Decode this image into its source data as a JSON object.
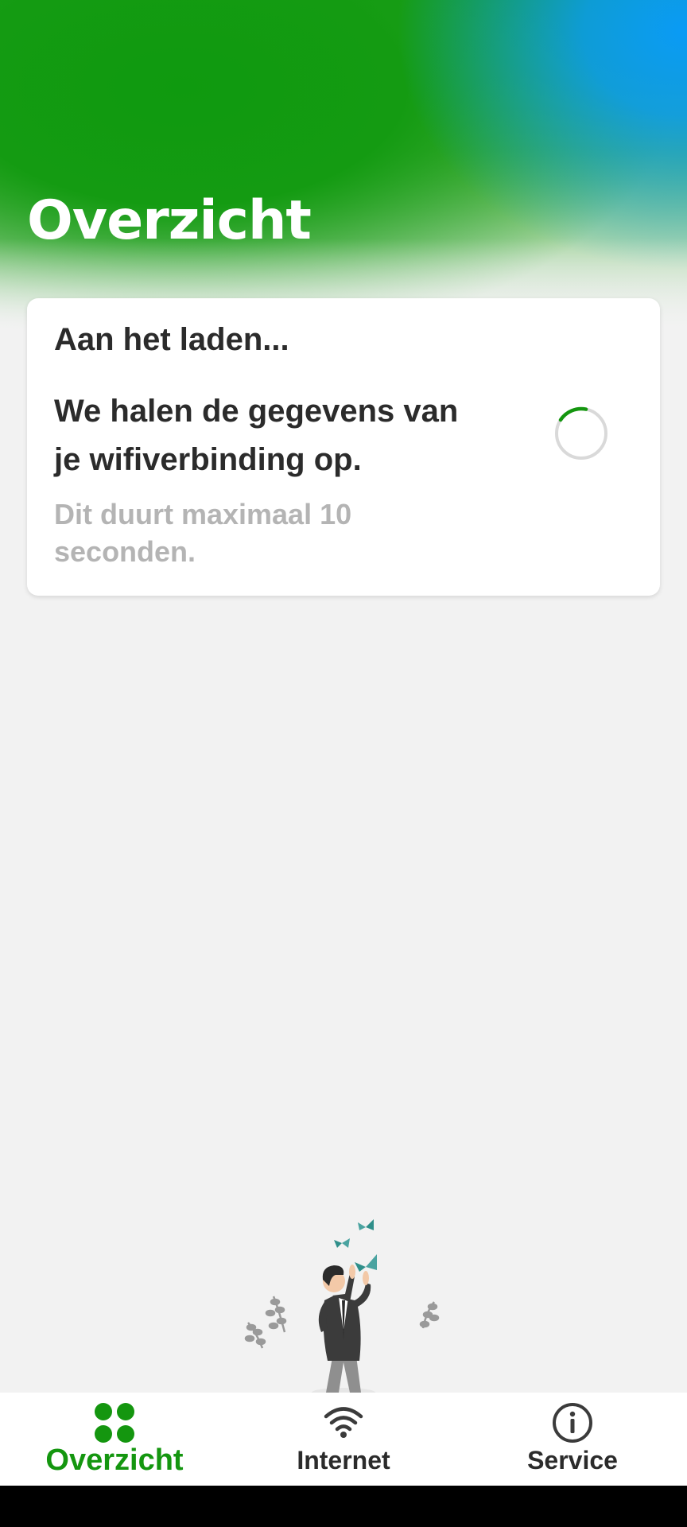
{
  "header": {
    "title": "Overzicht"
  },
  "loading_card": {
    "title": "Aan het laden...",
    "message": "We halen de gegevens van je wifiverbinding op.",
    "note": "Dit duurt maximaal 10 seconden."
  },
  "bottom_nav": {
    "items": [
      {
        "label": "Overzicht",
        "icon": "overview-grid-icon",
        "active": true
      },
      {
        "label": "Internet",
        "icon": "wifi-icon",
        "active": false
      },
      {
        "label": "Service",
        "icon": "info-icon",
        "active": false
      }
    ]
  },
  "colors": {
    "brand_green": "#14960f",
    "accent_blue": "#0a9bf5",
    "text_dark": "#2b2b2b",
    "text_muted": "#b4b4b4"
  }
}
